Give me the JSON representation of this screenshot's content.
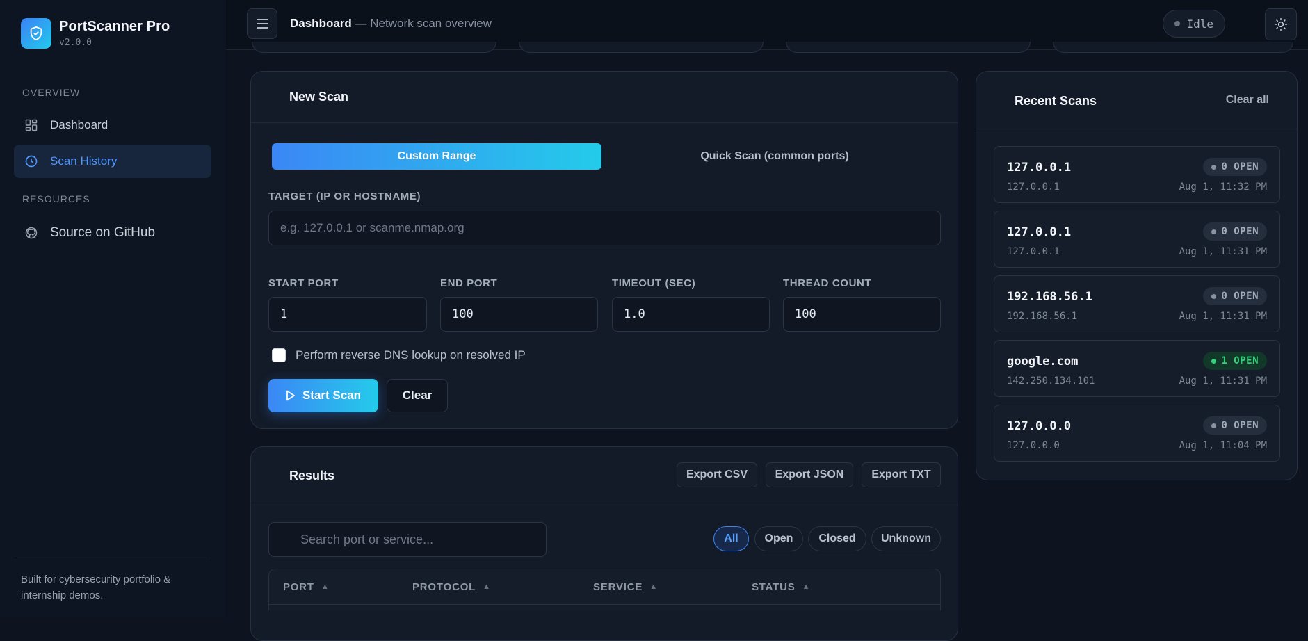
{
  "brand": {
    "title": "PortScanner Pro",
    "version": "v2.0.0"
  },
  "nav": {
    "overview_label": "OVERVIEW",
    "resources_label": "RESOURCES",
    "items": [
      {
        "label": "Dashboard",
        "icon": "grid-icon",
        "active": false
      },
      {
        "label": "Scan History",
        "icon": "clock-icon",
        "active": true
      },
      {
        "label": "Source on GitHub",
        "icon": "github-icon",
        "active": false
      }
    ]
  },
  "sidebar_footer": {
    "line1": "Built for cybersecurity portfolio &",
    "line2": "internship demos."
  },
  "topbar": {
    "page": "Dashboard",
    "subtitle": "— Network scan overview",
    "status": "Idle"
  },
  "new_scan": {
    "title": "New Scan",
    "modes": [
      "Custom Range",
      "Quick Scan (common ports)"
    ],
    "active_mode": "Custom Range",
    "target": {
      "label": "TARGET (IP OR HOSTNAME)",
      "placeholder": "e.g. 127.0.0.1 or scanme.nmap.org",
      "value": ""
    },
    "fields": [
      {
        "label": "START PORT",
        "value": "1"
      },
      {
        "label": "END PORT",
        "value": "100"
      },
      {
        "label": "TIMEOUT (SEC)",
        "value": "1.0"
      },
      {
        "label": "THREAD COUNT",
        "value": "100"
      }
    ],
    "reverse_dns": {
      "label": "Perform reverse DNS lookup on resolved IP",
      "checked": false
    },
    "start_label": "Start Scan",
    "clear_label": "Clear"
  },
  "results": {
    "title": "Results",
    "exports": [
      "Export CSV",
      "Export JSON",
      "Export TXT"
    ],
    "search_placeholder": "Search port or service...",
    "filters": [
      "All",
      "Open",
      "Closed",
      "Unknown"
    ],
    "active_filter": "All",
    "columns": [
      "PORT",
      "PROTOCOL",
      "SERVICE",
      "STATUS"
    ]
  },
  "recent": {
    "title": "Recent Scans",
    "clear_label": "Clear all",
    "items": [
      {
        "host": "127.0.0.1",
        "ip": "127.0.0.1",
        "badge": "0 OPEN",
        "open": false,
        "time": "Aug 1, 11:32 PM"
      },
      {
        "host": "127.0.0.1",
        "ip": "127.0.0.1",
        "badge": "0 OPEN",
        "open": false,
        "time": "Aug 1, 11:31 PM"
      },
      {
        "host": "192.168.56.1",
        "ip": "192.168.56.1",
        "badge": "0 OPEN",
        "open": false,
        "time": "Aug 1, 11:31 PM"
      },
      {
        "host": "google.com",
        "ip": "142.250.134.101",
        "badge": "1 OPEN",
        "open": true,
        "time": "Aug 1, 11:31 PM"
      },
      {
        "host": "127.0.0.0",
        "ip": "127.0.0.0",
        "badge": "0 OPEN",
        "open": false,
        "time": "Aug 1, 11:04 PM"
      }
    ]
  },
  "colors": {
    "accent": "#3b82f6",
    "accent_2": "#22c9ec",
    "open_green": "#34d17c",
    "bg": "#0e141f"
  }
}
